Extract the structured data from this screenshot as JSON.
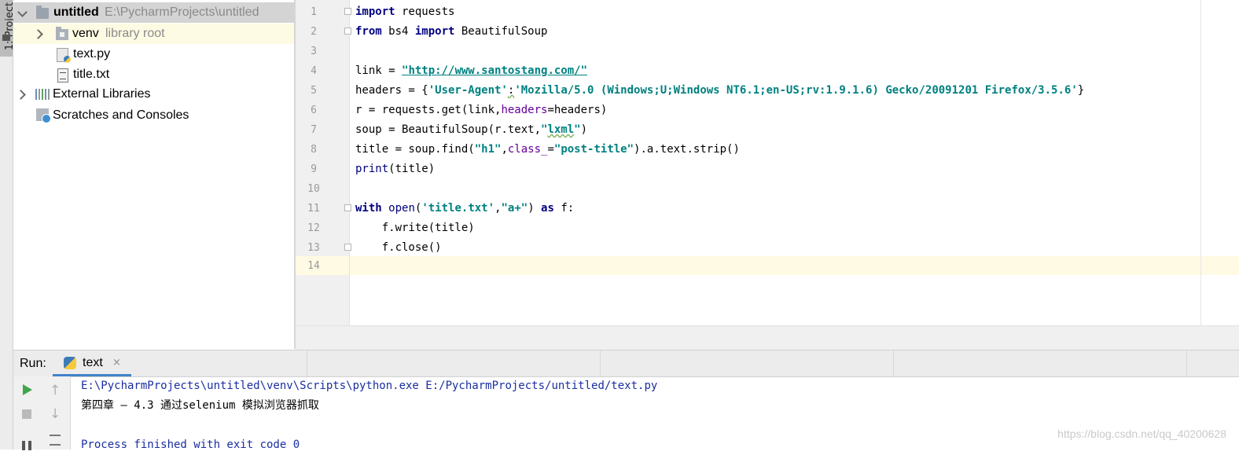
{
  "side_tab": {
    "label": "1: Project"
  },
  "tree": {
    "items": [
      {
        "name": "untitled",
        "hint": "E:\\PycharmProjects\\untitled"
      },
      {
        "name": "venv",
        "hint": "library root"
      },
      {
        "name": "text.py"
      },
      {
        "name": "title.txt"
      },
      {
        "name": "External Libraries"
      },
      {
        "name": "Scratches and Consoles"
      }
    ]
  },
  "editor": {
    "line_numbers": [
      "1",
      "2",
      "3",
      "4",
      "5",
      "6",
      "7",
      "8",
      "9",
      "10",
      "11",
      "12",
      "13",
      "14"
    ],
    "code": {
      "l1": [
        "import",
        " requests"
      ],
      "l2": [
        "from",
        " bs4 ",
        "import",
        " BeautifulSoup"
      ],
      "l4": [
        "link = ",
        "\"http://www.santostang.com/\""
      ],
      "l5": [
        "headers = {",
        "'User-Agent'",
        ":",
        "'Mozilla/5.0 (Windows;U;Windows NT6.1;en-US;rv:1.9.1.6) Gecko/20091201 Firefox/3.5.6'",
        "}"
      ],
      "l6": [
        "r = requests.get(link,",
        "headers",
        "=headers)"
      ],
      "l7": [
        "soup = BeautifulSoup(r.text,",
        "\"",
        "lxml",
        "\"",
        ")"
      ],
      "l8": [
        "title = soup.find(",
        "\"h1\"",
        ",",
        "class_",
        "=",
        "\"post-title\"",
        ").a.text.strip()"
      ],
      "l9": [
        "print",
        "(title)"
      ],
      "l11": [
        "with",
        " ",
        "open",
        "(",
        "'title.txt'",
        ",",
        "\"a+\"",
        ") ",
        "as",
        " f:"
      ],
      "l12": [
        "    f.write(title)"
      ],
      "l13": [
        "    f.close()"
      ]
    }
  },
  "run": {
    "label": "Run:",
    "tab_label": "text",
    "tab_close": "×",
    "output": [
      "E:\\PycharmProjects\\untitled\\venv\\Scripts\\python.exe E:/PycharmProjects/untitled/text.py",
      "第四章 – 4.3 通过selenium 模拟浏览器抓取",
      "",
      "Process finished with exit code 0"
    ],
    "output_colors": {
      "command": "#1a2ea0",
      "stdout": "#000000",
      "process": "#1a2ea0"
    }
  },
  "watermark": "https://blog.csdn.net/qq_40200628",
  "colors": {
    "keyword": "#000080",
    "string": "#008080",
    "param": "#660099",
    "selection": "#d4d4d4",
    "current_line": "#fffae3",
    "run_tab_underline": "#4083c9"
  }
}
